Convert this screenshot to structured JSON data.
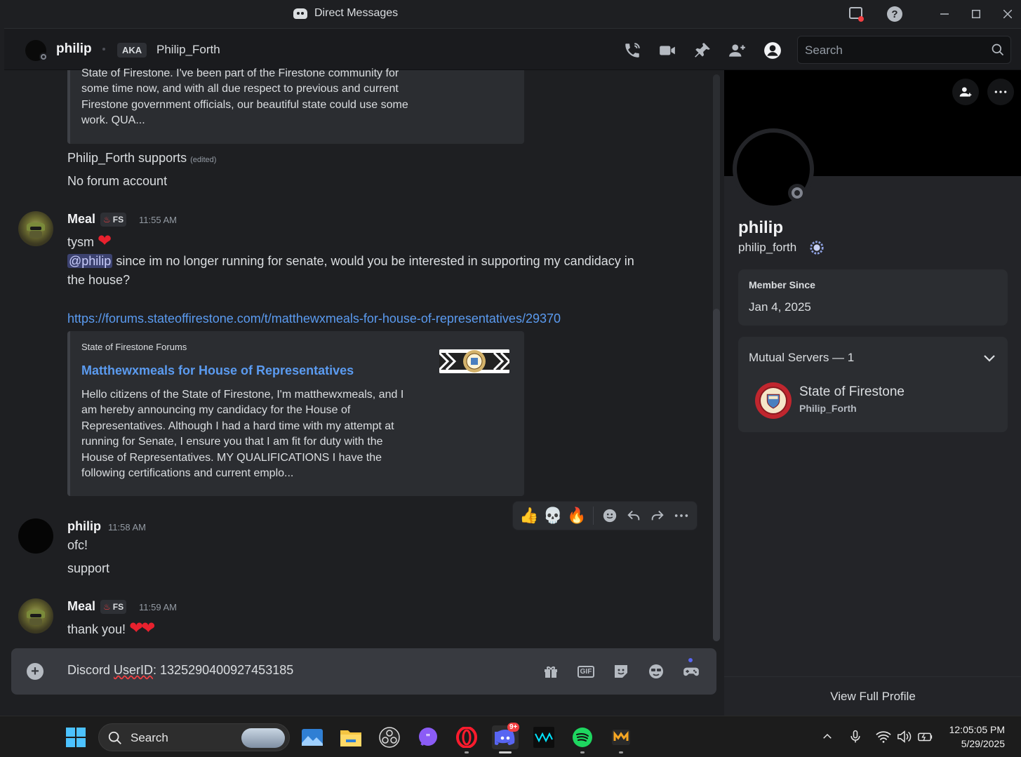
{
  "window": {
    "title": "Direct Messages",
    "buttons": [
      "inbox-icon",
      "help-icon",
      "minimize-icon",
      "maximize-icon",
      "close-icon"
    ]
  },
  "header": {
    "name": "philip",
    "aka_label": "AKA",
    "aka_name": "Philip_Forth",
    "search_placeholder": "Search",
    "icons": [
      "voice-call-icon",
      "video-call-icon",
      "pin-icon",
      "add-friends-to-dm-icon",
      "user-profile-icon"
    ]
  },
  "messages": {
    "embed_top": {
      "description_lines": [
        "State of Firestone. I've been part of the Firestone community for",
        "some time now, and with all due respect to previous and current",
        "Firestone government officials, our beautiful state could use some",
        "work. QUA..."
      ]
    },
    "block_a": {
      "line1": "Philip_Forth supports",
      "edited": "(edited)",
      "line2": "No forum account"
    },
    "msg1": {
      "author": "Meal",
      "tag": "FS",
      "time": "11:55 AM",
      "line1": "tysm",
      "mention": "@philip",
      "line2a": " since im no longer running for senate, would you be interested in supporting my candidacy in",
      "line2b": "the house?",
      "link": "https://forums.stateoffirestone.com/t/matthewxmeals-for-house-of-representatives/29370",
      "embed": {
        "provider": "State of Firestone Forums",
        "title": "Matthewxmeals for House of Representatives",
        "description_lines": [
          "Hello citizens of the State of Firestone, I'm matthewxmeals, and I",
          "am hereby announcing my candidacy for the House of",
          "Representatives. Although I had a hard time with my attempt at",
          "running for Senate, I ensure you that I am fit for duty with the",
          "House of Representatives. MY QUALIFICATIONS I have the",
          "following certifications and current emplo..."
        ]
      }
    },
    "msg2": {
      "author": "philip",
      "time": "11:58 AM",
      "line1": "ofc!",
      "line2": "support"
    },
    "msg3": {
      "author": "Meal",
      "tag": "FS",
      "time": "11:59 AM",
      "line1": "thank you!"
    },
    "hover_actions": [
      "thumbs-up-reaction",
      "skull-reaction",
      "fire-reaction",
      "add-reaction-icon",
      "reply-icon",
      "forward-icon",
      "more-icon"
    ]
  },
  "composer": {
    "text_prefix": "Discord ",
    "text_squiggle": "UserID",
    "text_suffix": ": 1325290400927453185",
    "icons": [
      "gift-icon",
      "gif-icon",
      "sticker-icon",
      "emoji-icon",
      "apps-icon"
    ],
    "gif_label": "GIF"
  },
  "profile": {
    "display_name": "philip",
    "username": "philip_forth",
    "member_since_label": "Member Since",
    "member_since_value": "Jan 4, 2025",
    "mutual_servers_label": "Mutual Servers — 1",
    "server_name": "State of Firestone",
    "server_nick": "Philip_Forth",
    "view_full_profile": "View Full Profile"
  },
  "taskbar": {
    "search_label": "Search",
    "discord_badge": "9+",
    "time": "12:05:05 PM",
    "date": "5/29/2025"
  },
  "colors": {
    "accent": "#5865f2",
    "link": "#5b9bf0",
    "heart": "#e8212e",
    "background": "#1e1f22"
  }
}
